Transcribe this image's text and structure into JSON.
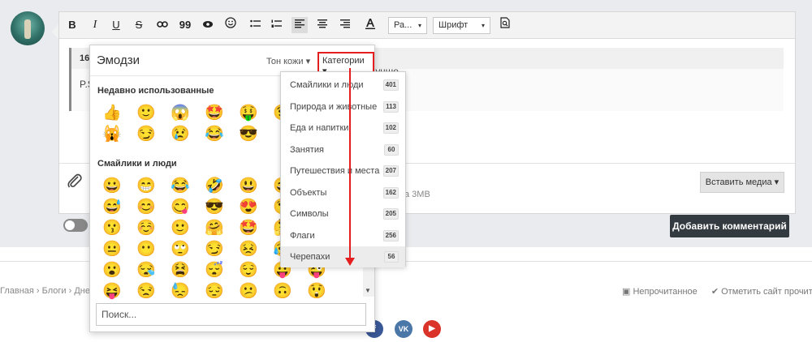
{
  "toolbar": {
    "bold": "B",
    "italic": "I",
    "underline": "U",
    "strike": "S",
    "quote": "99",
    "font_size_value": "Ра...",
    "font_family_value": "Шрифт"
  },
  "quote": {
    "header_prefix": "16",
    "text_prefix": "P.S",
    "text_right": "стал лучше"
  },
  "editor": {
    "limit_text": "а 3MB",
    "insert_media_label": "Вставить медиа ▾",
    "add_comment_label": "Добавить комментарий"
  },
  "emoji_panel": {
    "title": "Эмодзи",
    "skin_tone_label": "Тон кожи ▾",
    "categories_label": "Категории ▾",
    "recent_title": "Недавно использованные",
    "smileys_title": "Смайлики и люди",
    "search_placeholder": "Поиск...",
    "recent_rows": [
      [
        "👍",
        "🙂",
        "😱",
        "🤩",
        "🤑",
        "😉"
      ],
      [
        "🙀",
        "😏",
        "😢",
        "😂",
        "😎"
      ]
    ],
    "smiley_rows": [
      [
        "😀",
        "😁",
        "😂",
        "🤣",
        "😃",
        "😄"
      ],
      [
        "😅",
        "😊",
        "😋",
        "😎",
        "😍",
        "😘"
      ],
      [
        "😗",
        "☺️",
        "🙂",
        "🤗",
        "🤩",
        "🤔"
      ],
      [
        "😐",
        "😶",
        "🙄",
        "😏",
        "😣",
        "😥"
      ],
      [
        "😮",
        "😪",
        "😫",
        "😴",
        "😌",
        "😛",
        "😜"
      ],
      [
        "😝",
        "😒",
        "😓",
        "😔",
        "😕",
        "🙃",
        "😲"
      ]
    ]
  },
  "categories": [
    {
      "label": "Смайлики и люди",
      "count": "401"
    },
    {
      "label": "Природа и животные",
      "count": "113"
    },
    {
      "label": "Еда и напитки",
      "count": "102"
    },
    {
      "label": "Занятия",
      "count": "60"
    },
    {
      "label": "Путешествия и места",
      "count": "207"
    },
    {
      "label": "Объекты",
      "count": "162"
    },
    {
      "label": "Символы",
      "count": "205"
    },
    {
      "label": "Флаги",
      "count": "256"
    },
    {
      "label": "Черепахи",
      "count": "56"
    }
  ],
  "footer": {
    "breadcrumb": "Главная › Блоги › Дне",
    "unread": "▣ Непрочитанное",
    "mark_read": "✔ Отметить сайт прочитанным",
    "social_f": "f",
    "social_vk": "VK",
    "social_yt": "▶"
  },
  "colors": {
    "accent_red": "#e41e1e",
    "dark_button": "#333a40"
  }
}
